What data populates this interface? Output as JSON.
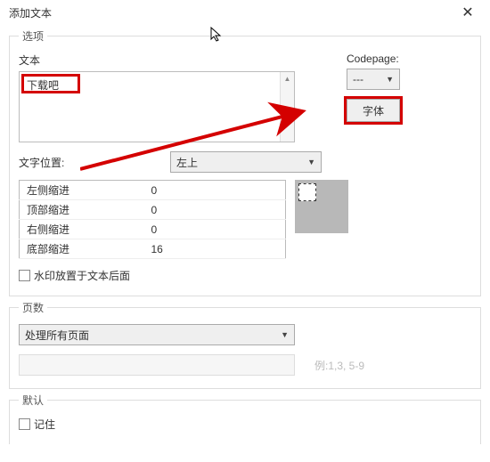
{
  "title": "添加文本",
  "options_legend": "选项",
  "text_label": "文本",
  "text_value": "下载吧",
  "codepage_label": "Codepage:",
  "codepage_value": "---",
  "font_btn": "字体",
  "position_label": "文字位置:",
  "position_value": "左上",
  "indent": [
    {
      "label": "左侧缩进",
      "val": "0"
    },
    {
      "label": "顶部缩进",
      "val": "0"
    },
    {
      "label": "右侧缩进",
      "val": "0"
    },
    {
      "label": "底部缩进",
      "val": "16"
    }
  ],
  "watermark_behind": "水印放置于文本后面",
  "pages_legend": "页数",
  "pages_value": "处理所有页面",
  "pages_placeholder": "例:1,3, 5-9",
  "default_legend": "默认",
  "remember": "记住"
}
